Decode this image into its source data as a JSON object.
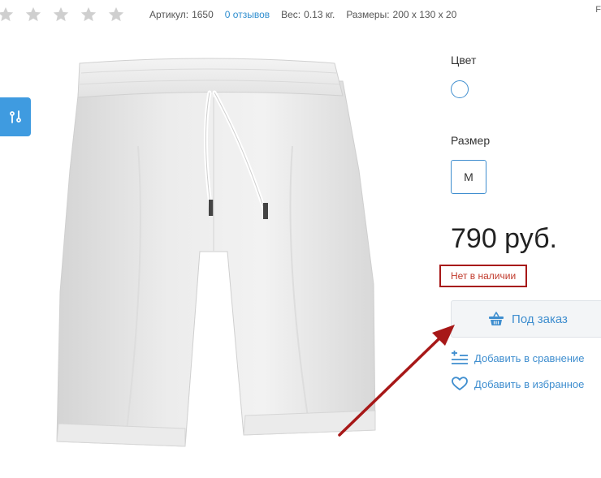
{
  "rating": {
    "stars": 5,
    "filled": 0
  },
  "meta": {
    "article_label": "Артикул:",
    "article_value": "1650",
    "reviews": "0 отзывов",
    "weight_label": "Вес:",
    "weight_value": "0.13 кг.",
    "sizes_label": "Размеры:",
    "sizes_value": "200 x 130 x 20",
    "corner_char": "F"
  },
  "options": {
    "color_label": "Цвет",
    "size_label": "Размер",
    "size_value": "M"
  },
  "price": "790 руб.",
  "stock_status": "Нет в наличии",
  "actions": {
    "order": "Под заказ",
    "compare": "Добавить в сравнение",
    "favorite": "Добавить в избранное"
  },
  "colors": {
    "accent": "#3f8ecf",
    "filter_button": "#3f9be0",
    "annotation": "#a71818"
  },
  "icons": {
    "filter": "filter-icon",
    "basket": "basket-icon",
    "compare": "compare-icon",
    "heart": "heart-icon"
  }
}
